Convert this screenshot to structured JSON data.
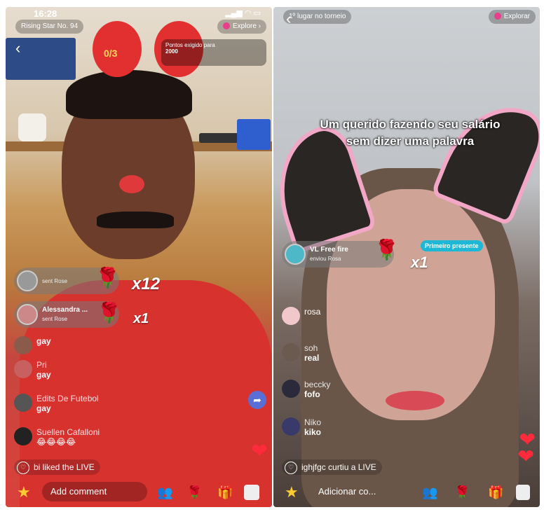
{
  "left": {
    "status": {
      "time": "16:28",
      "sys": "▂▄▆ ◠ ▭"
    },
    "header": {
      "rank_pill": "Rising Star No. 94",
      "explore": "Explore"
    },
    "score": "0/3",
    "points_box": {
      "line1": "Pontos exigido para",
      "line2": "2000"
    },
    "gifts": [
      {
        "name": "",
        "sub": "sent Rose",
        "multiplier": "x12"
      },
      {
        "name": "Alessandra ...",
        "sub": "sent Rose",
        "multiplier": "x1"
      }
    ],
    "comments": [
      {
        "name": "",
        "message": "gay"
      },
      {
        "name": "Pri",
        "message": "gay"
      },
      {
        "name": "Edits De Futebol",
        "message": "gay"
      },
      {
        "name": "Suellen Cafalloni",
        "message": "😂😂😂😂"
      }
    ],
    "liked": "bi liked the LIVE",
    "add_comment": "Add comment"
  },
  "right": {
    "header": {
      "rank_pill": "1º lugar no torneio",
      "explore": "Explorar"
    },
    "caption": "Um querido fazendo seu salário sem dizer uma palavra",
    "gift": {
      "name": "VL Free fire",
      "sub": "enviou Rosa",
      "multiplier": "x1",
      "badge": "Primeiro presente"
    },
    "comments": [
      {
        "name": "",
        "message": "rosa"
      },
      {
        "name": "soh",
        "message": "real"
      },
      {
        "name": "beccky",
        "message": "fofo"
      },
      {
        "name": "Niko",
        "message": "kiko"
      }
    ],
    "liked": "ighjfgc curtiu a LIVE",
    "add_comment": "Adicionar co..."
  },
  "icons": {
    "rose": "🌹",
    "star": "★",
    "heart": "❤",
    "gift": "🎁",
    "people": "👥",
    "share": "➦"
  },
  "colors": {
    "rose": "#e0202c",
    "badge": "#1fb7d6",
    "explore_dot": "#e83e8c"
  }
}
